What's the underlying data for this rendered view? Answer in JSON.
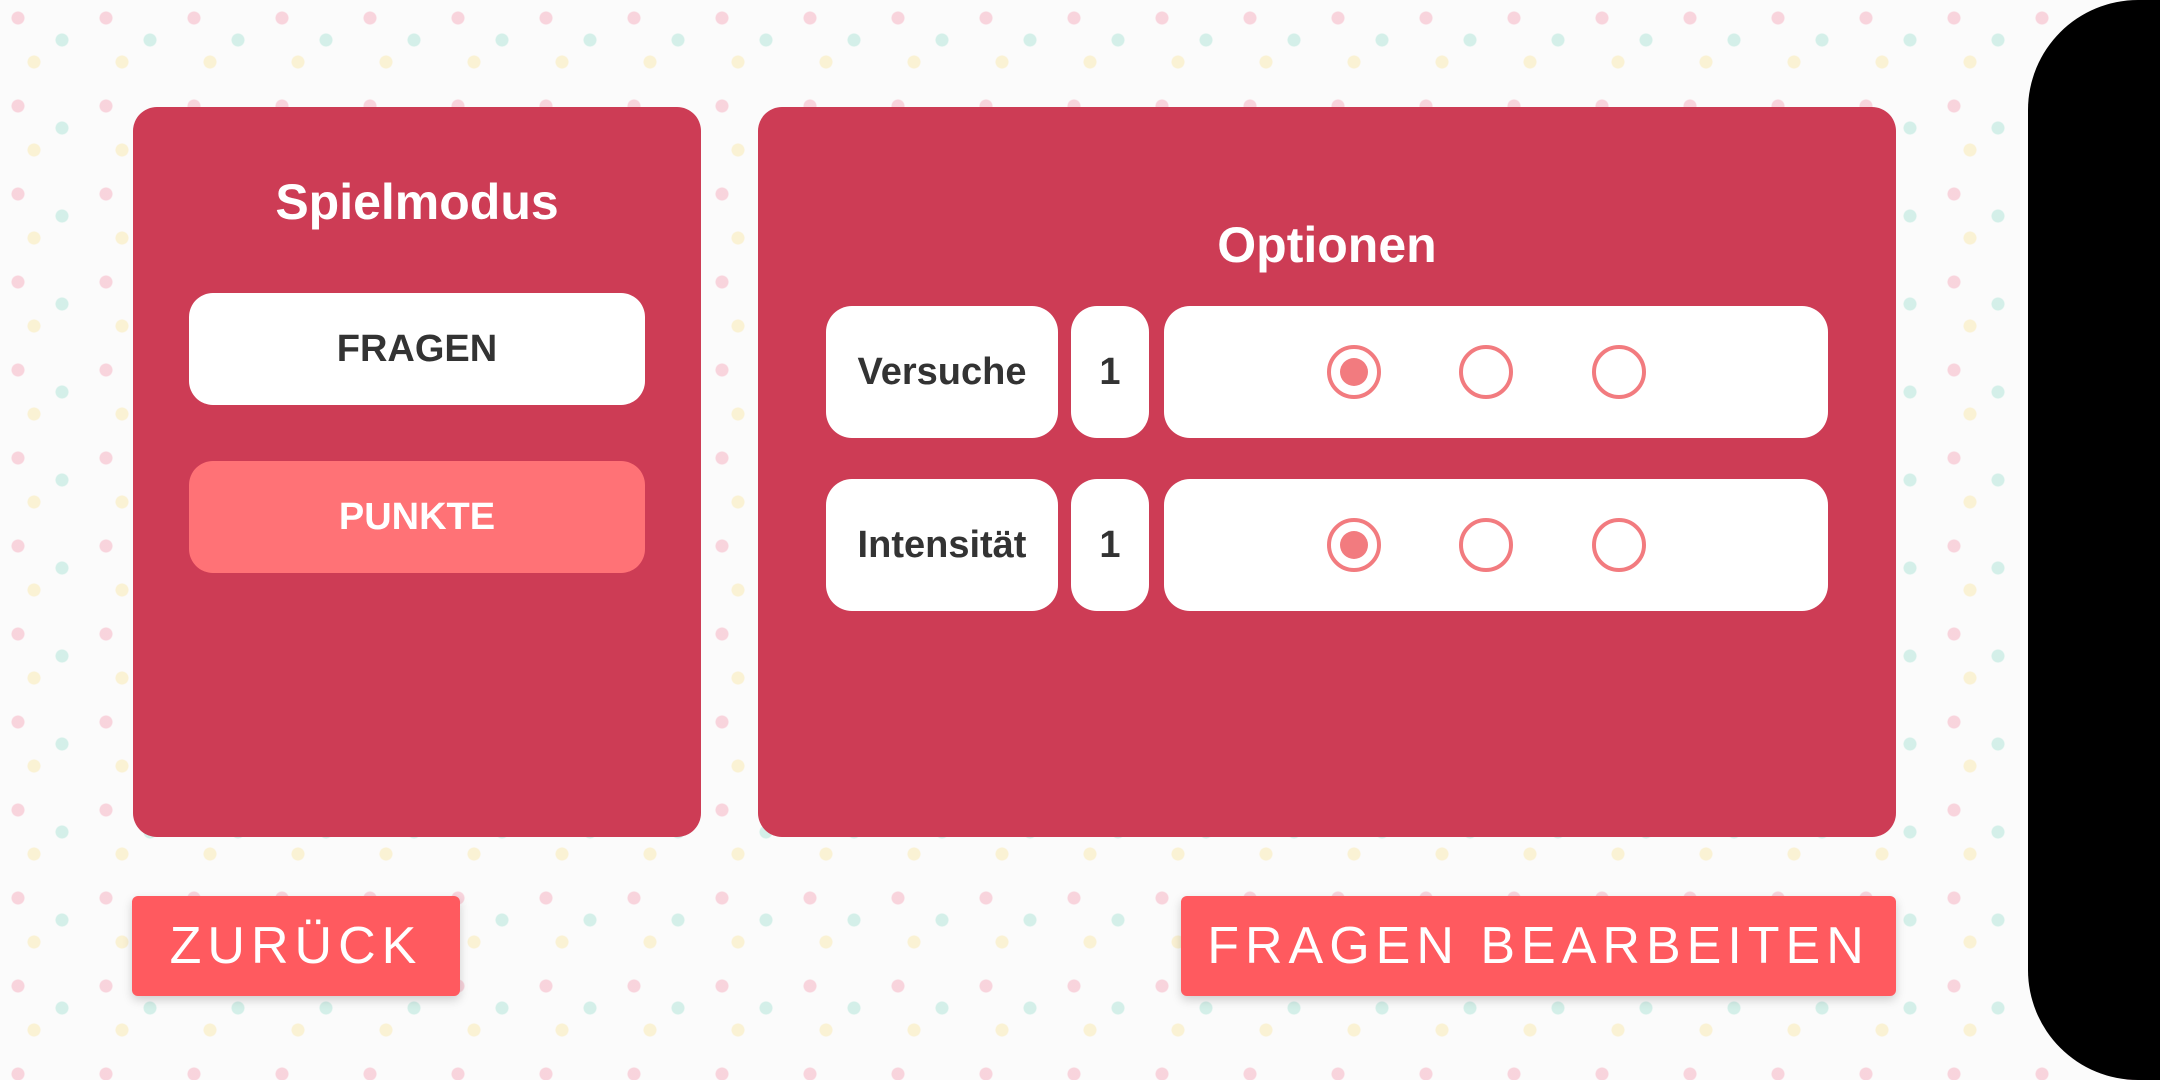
{
  "colors": {
    "panel_bg": "#cd3c55",
    "active_button_bg": "#ff7276",
    "inactive_button_bg": "#ffffff",
    "dark_text": "#333333",
    "accent": "#f27b7f",
    "action_button_bg": "#ff5a5f"
  },
  "mode_panel": {
    "title": "Spielmodus",
    "options": [
      {
        "label": "FRAGEN",
        "selected": false
      },
      {
        "label": "PUNKTE",
        "selected": true
      }
    ]
  },
  "options_panel": {
    "title": "Optionen",
    "rows": [
      {
        "label": "Versuche",
        "value": "1",
        "selected_index": 0,
        "radio_count": 3
      },
      {
        "label": "Intensität",
        "value": "1",
        "selected_index": 0,
        "radio_count": 3
      }
    ]
  },
  "footer": {
    "back_label": "ZURÜCK",
    "edit_label": "FRAGEN BEARBEITEN"
  }
}
